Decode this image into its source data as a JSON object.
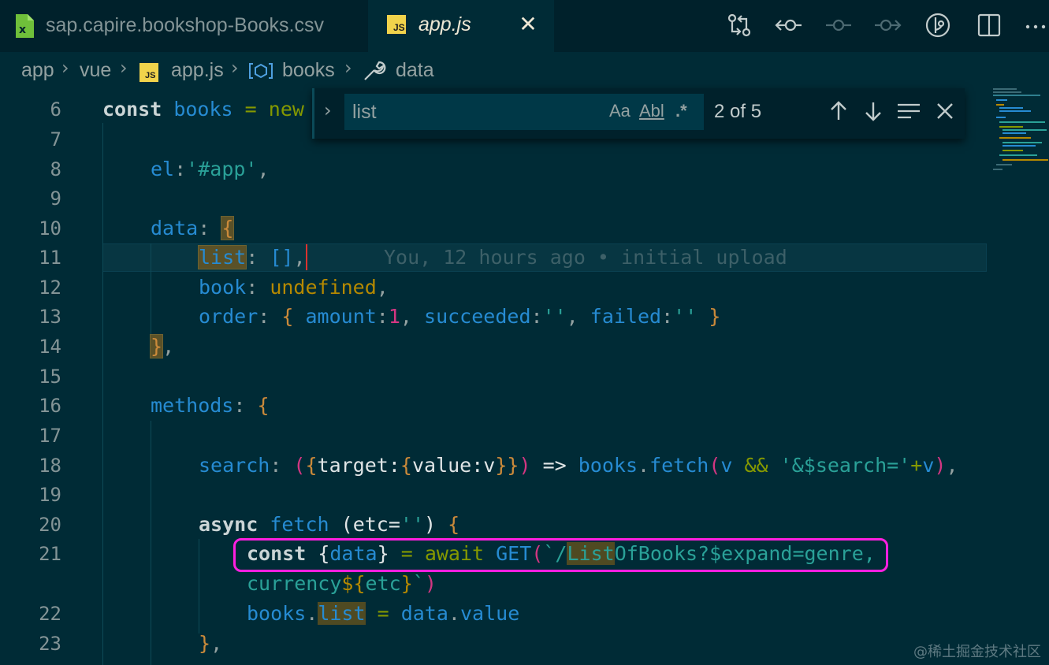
{
  "tabs": [
    {
      "label": "sap.capire.bookshop-Books.csv",
      "icon": "csv-file-icon"
    },
    {
      "label": "app.js",
      "icon": "js-file-icon",
      "badge": "JS",
      "active": true
    }
  ],
  "toolbar_icons": [
    "git-compare-icon",
    "go-back-icon",
    "timeline-icon",
    "go-forward-icon",
    "git-graph-icon",
    "split-editor-icon",
    "more-actions-icon"
  ],
  "breadcrumb": [
    "app",
    "vue",
    "app.js",
    "books",
    "data"
  ],
  "find": {
    "query": "list",
    "match_case": "Aa",
    "whole_word": "Abl",
    "regex": ".*",
    "count": "2 of 5"
  },
  "blame": "You, 12 hours ago • initial upload",
  "line_numbers": [
    "6",
    "7",
    "8",
    "9",
    "10",
    "11",
    "12",
    "13",
    "14",
    "15",
    "16",
    "17",
    "18",
    "19",
    "20",
    "21",
    "",
    "22",
    "23"
  ],
  "code": {
    "l6": {
      "kw": "const",
      "var": "books",
      "eq": "=",
      "new": "new"
    },
    "l8": {
      "prop": "el",
      "colon": ":",
      "str": "'#app'",
      "comma": ","
    },
    "l10": {
      "prop": "data",
      "colon": ": ",
      "brace": "{"
    },
    "l11": {
      "prop": "list",
      "colon": ": ",
      "arr": "[]",
      "comma": ","
    },
    "l12": {
      "prop": "book",
      "colon": ": ",
      "val": "undefined",
      "comma": ","
    },
    "l13": {
      "prop": "order",
      "colon": ": ",
      "ob": "{ ",
      "p1": "amount",
      "c1": ":",
      "n1": "1",
      "sep1": ", ",
      "p2": "succeeded",
      "c2": ":",
      "s2": "''",
      "sep2": ", ",
      "p3": "failed",
      "c3": ":",
      "s3": "''",
      "cb": " }"
    },
    "l14": {
      "brace": "}",
      "comma": ","
    },
    "l16": {
      "prop": "methods",
      "colon": ": ",
      "brace": "{"
    },
    "l18": {
      "prop": "search",
      "colon": ": ",
      "p1": "(",
      "b1": "{",
      "t1": "target:",
      "b2": "{",
      "t2": "value:v",
      "b3": "}",
      "b4": "}",
      "p2": ")",
      "arrow": " => ",
      "obj": "books",
      "dot": ".",
      "fn": "fetch",
      "p3": "(",
      "v": "v",
      "and": " && ",
      "s": "'&$search='",
      "plus": "+",
      "v2": "v",
      "p4": ")",
      "end": ","
    },
    "l20": {
      "kw": "async",
      "fn": "fetch",
      "args": " (etc=",
      "s": "''",
      "close": ") ",
      "brace": "{"
    },
    "l21": {
      "kw": "const",
      "b1": " {",
      "v": "data",
      "b2": "}",
      "eq": " = ",
      "aw": "await",
      "get": " GET",
      "p": "(",
      "s1": "`/",
      "hl": "List",
      "s2": "OfBooks?$expand=genre,"
    },
    "l21b": {
      "s1": "currency",
      "d": "${",
      "v": "etc",
      "c": "}",
      "bt": "`",
      "p": ")"
    },
    "l22": {
      "obj": "books",
      "dot": ".",
      "hl": "list",
      "eq": " = ",
      "v": "data",
      "dot2": ".",
      "val": "value"
    },
    "l23": {
      "brace": "}",
      "comma": ","
    }
  },
  "watermark": "@稀土掘金技术社区"
}
